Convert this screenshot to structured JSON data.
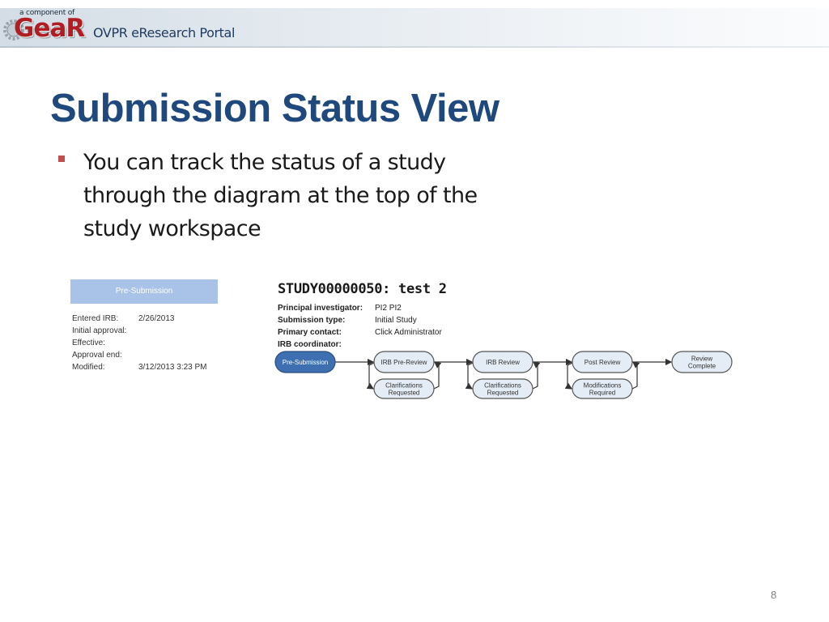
{
  "header": {
    "logo_sub": "a component of",
    "logo_main": "GeaR",
    "portal_name": "OVPR eResearch Portal",
    "logo_color": "#b01e23"
  },
  "slide": {
    "title": "Submission Status View",
    "bullet": "You can track the status of a study through the diagram at the top of the study workspace",
    "title_color": "#1f497d",
    "bullet_color": "#c0504d",
    "page_number": "8"
  },
  "status_panel": {
    "state": "Pre-Submission",
    "rows": [
      {
        "label": "Entered IRB:",
        "value": "2/26/2013"
      },
      {
        "label": "Initial approval:",
        "value": ""
      },
      {
        "label": "Effective:",
        "value": ""
      },
      {
        "label": "Approval end:",
        "value": ""
      },
      {
        "label": "Modified:",
        "value": "3/12/2013 3:23 PM"
      }
    ]
  },
  "study": {
    "title": "STUDY00000050: test 2",
    "fields": [
      {
        "label": "Principal investigator:",
        "value": "PI2 PI2"
      },
      {
        "label": "Submission type:",
        "value": "Initial Study"
      },
      {
        "label": "Primary contact:",
        "value": "Click Administrator"
      },
      {
        "label": "IRB coordinator:",
        "value": ""
      }
    ]
  },
  "workflow": {
    "main_steps": [
      {
        "lines": [
          "Pre-Submission"
        ],
        "active": true
      },
      {
        "lines": [
          "IRB Pre-Review"
        ],
        "active": false
      },
      {
        "lines": [
          "IRB Review"
        ],
        "active": false
      },
      {
        "lines": [
          "Post Review"
        ],
        "active": false
      },
      {
        "lines": [
          "Review",
          "Complete"
        ],
        "active": false
      }
    ],
    "side_steps": [
      {
        "lines": [
          "Clarifications",
          "Requested"
        ]
      },
      {
        "lines": [
          "Clarifications",
          "Requested"
        ]
      },
      {
        "lines": [
          "Modifications",
          "Required"
        ]
      }
    ],
    "active_color": "#3e6fb0",
    "node_color": "#e4ecf5"
  }
}
